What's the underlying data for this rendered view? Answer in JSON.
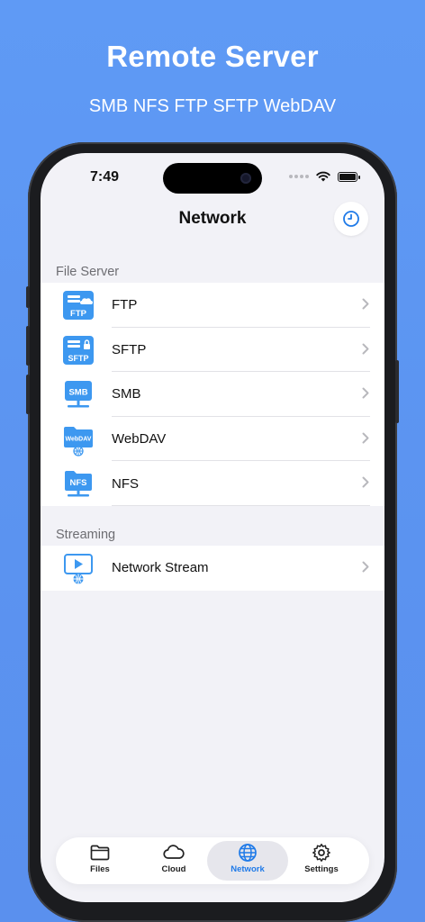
{
  "hero": {
    "title": "Remote Server",
    "subtitle": "SMB NFS FTP SFTP WebDAV"
  },
  "status_bar": {
    "time": "7:49"
  },
  "nav": {
    "title": "Network",
    "history_icon": "clock-icon"
  },
  "sections": [
    {
      "header": "File Server",
      "items": [
        {
          "label": "FTP",
          "icon": "ftp-server-icon",
          "badge": "FTP"
        },
        {
          "label": "SFTP",
          "icon": "sftp-server-icon",
          "badge": "SFTP"
        },
        {
          "label": "SMB",
          "icon": "smb-server-icon",
          "badge": "SMB"
        },
        {
          "label": "WebDAV",
          "icon": "webdav-folder-icon",
          "badge": "WebDAV"
        },
        {
          "label": "NFS",
          "icon": "nfs-server-icon",
          "badge": "NFS"
        }
      ]
    },
    {
      "header": "Streaming",
      "items": [
        {
          "label": "Network Stream",
          "icon": "network-stream-icon"
        }
      ]
    }
  ],
  "tabbar": {
    "active": "Network",
    "tabs": [
      {
        "label": "Files",
        "icon": "folder-icon"
      },
      {
        "label": "Cloud",
        "icon": "cloud-icon"
      },
      {
        "label": "Network",
        "icon": "globe-icon"
      },
      {
        "label": "Settings",
        "icon": "gear-icon"
      }
    ]
  },
  "colors": {
    "background": "#5f9af5",
    "accent": "#1f7ae8",
    "icon_blue": "#3d98f0"
  }
}
